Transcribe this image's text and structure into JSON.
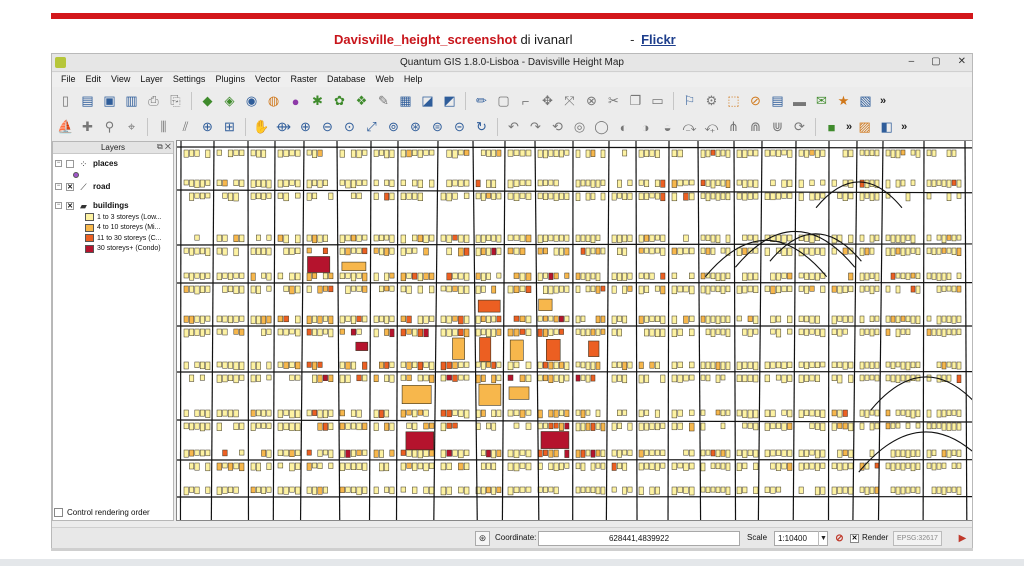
{
  "caption": {
    "title": "Davisville_height_screenshot",
    "by": "di ivanarl",
    "dash": "-",
    "link": "Flickr"
  },
  "window": {
    "title": "Quantum GIS 1.8.0-Lisboa - Davisville Height Map",
    "minimize": "–",
    "maximize": "▢",
    "close": "✕"
  },
  "menu": [
    "File",
    "Edit",
    "View",
    "Layer",
    "Settings",
    "Plugins",
    "Vector",
    "Raster",
    "Database",
    "Web",
    "Help"
  ],
  "layers_panel": {
    "title": "Layers",
    "layers": [
      {
        "name": "places",
        "checked": false
      },
      {
        "name": "road",
        "checked": true
      },
      {
        "name": "buildings",
        "checked": true
      }
    ],
    "legend": [
      {
        "label": "1 to 3 storeys (Low...",
        "color": "#fdf2a2"
      },
      {
        "label": "4 to 10 storeys (Mi...",
        "color": "#f7b74c"
      },
      {
        "label": "11 to 30 storeys (C...",
        "color": "#ec5f22"
      },
      {
        "label": "30 storeys+ (Condo)",
        "color": "#b5132d"
      }
    ],
    "place_color": "#a056c9",
    "control_rendering_order": "Control rendering order"
  },
  "statusbar": {
    "coordinate_label": "Coordinate:",
    "coordinate_value": "628441,4839922",
    "scale_label": "Scale",
    "scale_value": "1:10400",
    "render_label": "Render",
    "render_checked": true,
    "epsg": "EPSG:32617"
  },
  "map_style": {
    "road_color": "#111111",
    "building_outline": "#3a3320"
  }
}
